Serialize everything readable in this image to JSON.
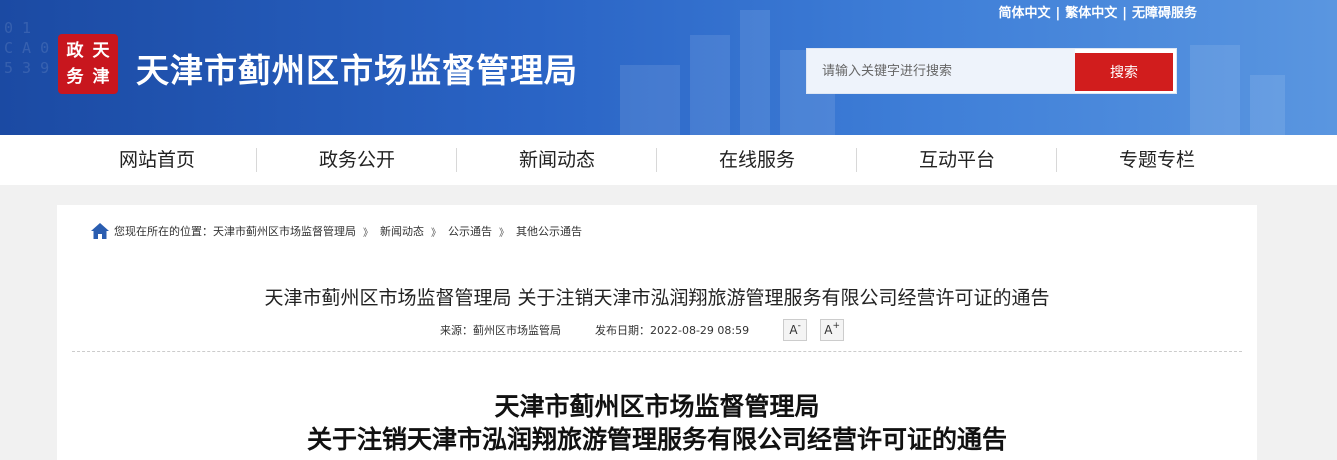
{
  "header": {
    "lang_simplified": "简体中文",
    "lang_traditional": "繁体中文",
    "lang_accessible": "无障碍服务",
    "lang_separator": "|",
    "logo_chars": [
      "天",
      "津",
      "政",
      "务"
    ],
    "site_title": "天津市蓟州区市场监督管理局",
    "search_placeholder": "请输入关键字进行搜索",
    "search_button": "搜索",
    "brand_color": "#1b4aa3",
    "accent_color": "#d11d1d"
  },
  "nav": {
    "items": [
      "网站首页",
      "政务公开",
      "新闻动态",
      "在线服务",
      "互动平台",
      "专题专栏"
    ]
  },
  "breadcrumb": {
    "prefix": "您现在所在的位置：",
    "items": [
      "天津市蓟州区市场监督管理局",
      "新闻动态",
      "公示通告",
      "其他公示通告"
    ],
    "arrow": "》"
  },
  "article": {
    "title": "天津市蓟州区市场监督管理局 关于注销天津市泓润翔旅游管理服务有限公司经营许可证的通告",
    "source": "来源：蓟州区市场监管局",
    "published": "发布日期：2022-08-29 08:59",
    "font_decrease": "A",
    "font_decrease_sup": "-",
    "font_increase": "A",
    "font_increase_sup": "+",
    "doc_title_line1": "天津市蓟州区市场监督管理局",
    "doc_title_line2": "关于注销天津市泓润翔旅游管理服务有限公司经营许可证的通告"
  }
}
